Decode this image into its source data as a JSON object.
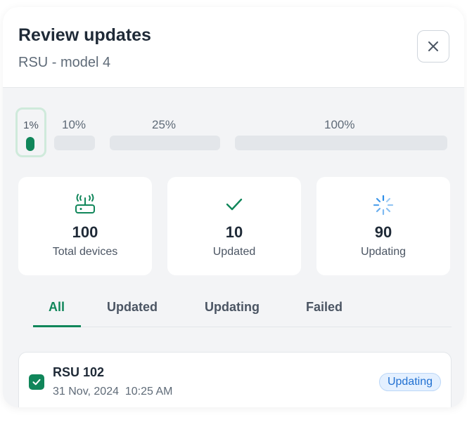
{
  "header": {
    "title": "Review updates",
    "subtitle": "RSU - model 4",
    "close_icon": "close-icon"
  },
  "rollout": {
    "active_stage": "1%",
    "stages": [
      {
        "label": "1%"
      },
      {
        "label": "10%"
      },
      {
        "label": "25%"
      },
      {
        "label": "100%"
      }
    ]
  },
  "stats": [
    {
      "icon": "router-icon",
      "value": "100",
      "label": "Total devices"
    },
    {
      "icon": "check-icon",
      "value": "10",
      "label": "Updated"
    },
    {
      "icon": "loading-spinner-icon",
      "value": "90",
      "label": "Updating"
    }
  ],
  "tabs": [
    {
      "label": "All",
      "active": true
    },
    {
      "label": "Updated",
      "active": false
    },
    {
      "label": "Updating",
      "active": false
    },
    {
      "label": "Failed",
      "active": false
    }
  ],
  "devices": [
    {
      "name": "RSU 102",
      "date": "31 Nov, 2024  10:25 AM",
      "status": "Updating",
      "checked": true
    }
  ],
  "colors": {
    "accent": "#10865a",
    "badge_text": "#1f6fd1",
    "badge_bg": "#e4f0ff",
    "spinner": "#2b8de8"
  }
}
